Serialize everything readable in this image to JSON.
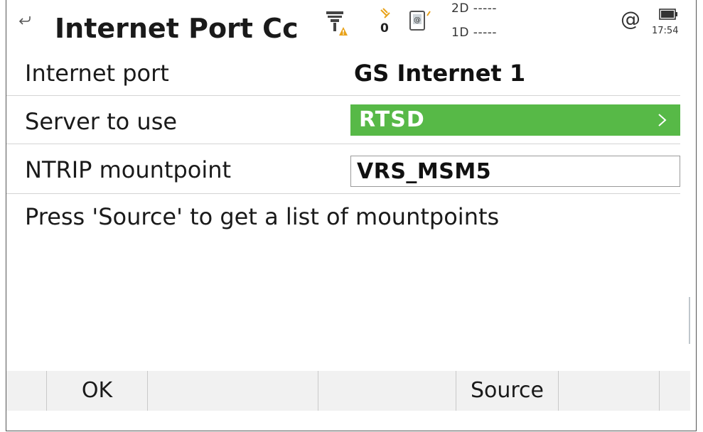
{
  "window": {
    "title": "Internet Port Cc",
    "back_icon": "back-arrow-icon"
  },
  "status_bar": {
    "gnss_icon": "gnss-antenna-warning-icon",
    "satellite_icon": "satellite-icon",
    "satellite_count": "0",
    "device_icon": "controller-link-icon",
    "precision_2d": "2D -----",
    "precision_1d": "1D -----",
    "internet_icon": "at-icon",
    "internet_symbol": "@",
    "battery_icon": "battery-icon",
    "time": "17:54",
    "warning_color": "#e8a21a",
    "accent_color": "#57b947"
  },
  "form": {
    "internet_port": {
      "label": "Internet port",
      "value": "GS Internet 1"
    },
    "server": {
      "label": "Server to use",
      "value": "RTSD",
      "chevron": ">"
    },
    "mountpoint": {
      "label": "NTRIP mountpoint",
      "value": "VRS_MSM5"
    },
    "hint": "Press 'Source' to get a list of mountpoints"
  },
  "softkeys": [
    "",
    "OK",
    "",
    "",
    "Source",
    "",
    ""
  ]
}
